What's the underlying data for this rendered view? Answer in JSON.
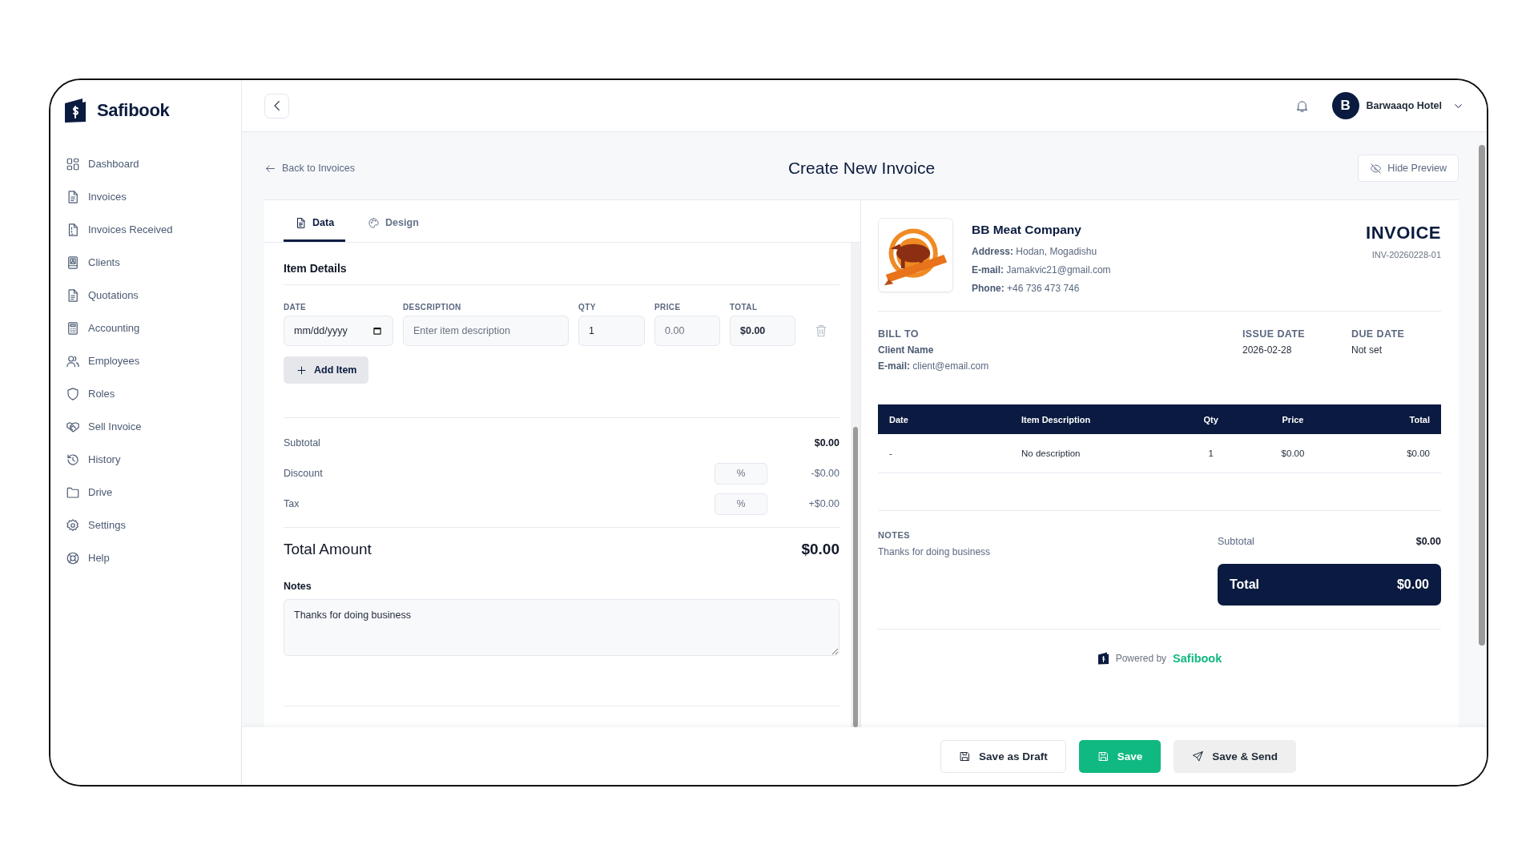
{
  "brand": {
    "name": "Safibook"
  },
  "sidebar": {
    "items": [
      {
        "label": "Dashboard",
        "selected": false
      },
      {
        "label": "Invoices",
        "selected": false
      },
      {
        "label": "Invoices Received",
        "selected": false
      },
      {
        "label": "Clients",
        "selected": false
      },
      {
        "label": "Quotations",
        "selected": false
      },
      {
        "label": "Accounting",
        "selected": false
      },
      {
        "label": "Employees",
        "selected": false
      },
      {
        "label": "Roles",
        "selected": false
      },
      {
        "label": "Sell Invoice",
        "selected": false
      },
      {
        "label": "History",
        "selected": false
      },
      {
        "label": "Drive",
        "selected": false
      },
      {
        "label": "Settings",
        "selected": false
      },
      {
        "label": "Help",
        "selected": false
      }
    ]
  },
  "topbar": {
    "user": {
      "initial": "B",
      "name": "Barwaaqo Hotel"
    }
  },
  "page": {
    "back_link": "Back to Invoices",
    "title": "Create New Invoice",
    "hide_preview": "Hide Preview"
  },
  "tabs": [
    {
      "label": "Data",
      "selected": true
    },
    {
      "label": "Design",
      "selected": false
    }
  ],
  "form": {
    "section_title": "Item Details",
    "columns": [
      "DATE",
      "DESCRIPTION",
      "QTY",
      "PRICE",
      "TOTAL"
    ],
    "items": [
      {
        "date": "mm/dd/yyyy",
        "description_placeholder": "Enter item description",
        "qty": "1",
        "price_placeholder": "0.00",
        "total": "$0.00"
      }
    ],
    "add_item": "Add Item",
    "summary": [
      {
        "label": "Subtotal",
        "value": "$0.00",
        "kind": "plain"
      },
      {
        "label": "Discount",
        "placeholder": "%",
        "value": "-$0.00",
        "kind": "percent"
      },
      {
        "label": "Tax",
        "placeholder": "%",
        "value": "+$0.00",
        "kind": "percent"
      }
    ],
    "total": {
      "label": "Total Amount",
      "value": "$0.00"
    },
    "notes": {
      "label": "Notes",
      "value": "Thanks for doing business"
    }
  },
  "preview": {
    "company": {
      "name": "BB Meat Company",
      "lines": [
        "**Address:** Hodan, Mogadishu",
        "**E-mail:** Jamakvic21@gmail.com",
        "**Phone:** +46 736 473 746"
      ]
    },
    "doc_title": "INVOICE",
    "number": "INV-20260228-01",
    "bill_to": {
      "heading": "BILL TO",
      "name": "Client Name",
      "email": "**E-mail:** client@email.com"
    },
    "issue_date": {
      "heading": "ISSUE DATE",
      "value": "2026-02-28"
    },
    "due_date": {
      "heading": "DUE DATE",
      "value": "Not set"
    },
    "table": {
      "columns": [
        "Date",
        "Item Description",
        "Qty",
        "Price",
        "Total"
      ],
      "rows": [
        [
          "-",
          "No description",
          "1",
          "$0.00",
          "$0.00"
        ]
      ]
    },
    "notes": {
      "heading": "NOTES",
      "text": "Thanks for doing business"
    },
    "subtotal": {
      "label": "Subtotal",
      "value": "$0.00"
    },
    "total": {
      "label": "Total",
      "value": "$0.00"
    },
    "powered": {
      "prefix": "Powered by",
      "brand": "Safibook"
    }
  },
  "actions": [
    {
      "label": "Save as Draft",
      "kind": "outline"
    },
    {
      "label": "Save",
      "kind": "primary"
    },
    {
      "label": "Save & Send",
      "kind": "secondary"
    }
  ]
}
